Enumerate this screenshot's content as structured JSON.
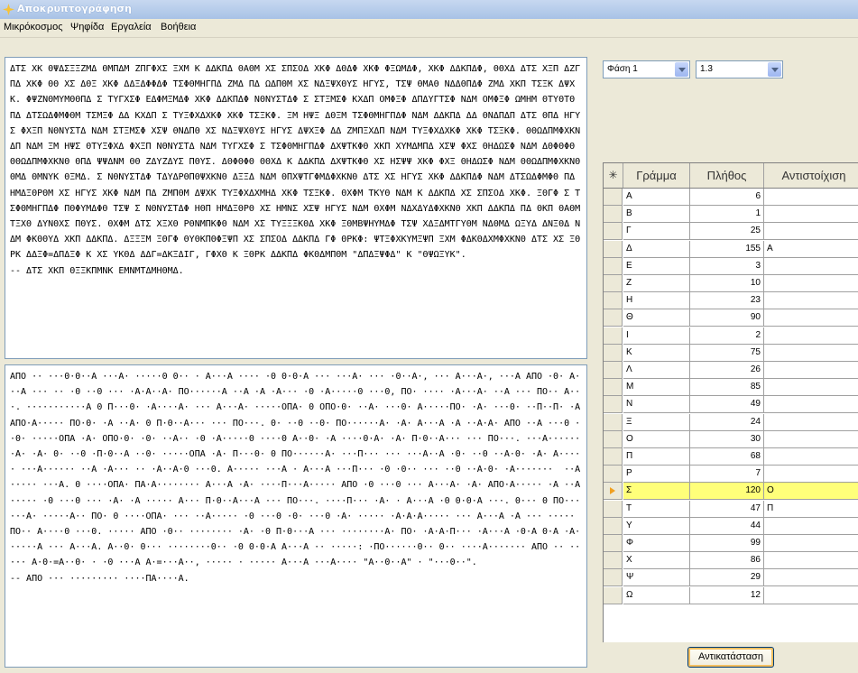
{
  "window": {
    "title": "Αποκρυπτογράφηση"
  },
  "menu": [
    "Μικρόκοσμος",
    "Ψηφίδα",
    "Εργαλεία",
    "Βοήθεια"
  ],
  "cipher_text": "ΔΤΣ ΧΚ ΘΨΔΣΞΞΖΜΔ ΘΜΠΔΜ ΖΠΓΦΧΣ ΞΧΜ Κ ΔΔΚΠΔ ΘΑΘΜ ΧΣ ΣΠΣΟΔ ΧΚΦ ΔΘΔΦ ΧΚΦ ΦΞΩΜΔΦ, ΧΚΦ ΔΔΚΠΔΦ, ΘΘΧΔ ΔΤΣ ΧΞΠ ΔΖΓΠΔ ΧΚΦ ΘΘ ΧΣ ΔΘΞ ΧΚΦ ΔΔΞΔΦΦΔΦ ΤΣΦΘΜΗΓΠΔ ΖΜΔ ΠΔ ΩΔΠΘΜ ΧΣ ΝΔΞΨΧΘΥΣ ΗΓΥΣ, ΤΣΨ ΘΜΑΘ ΝΔΔΘΠΔΦ ΖΜΔ ΧΚΠ ΤΣΞΚ ΔΨΧΚ. ΦΨΖΝΘΜΥΜΘΘΠΔ Σ ΤΥΓΧΣΦ ΕΔΦΜΞΜΔΦ ΧΚΦ ΔΔΚΠΔΦ ΝΘΝΥΣΤΔΦ Σ ΣΤΞΜΣΦ ΚΧΔΠ ΟΜΦΞΦ ΔΠΔΥΓΤΣΦ ΝΔΜ ΟΜΦΞΦ ΩΜΗΜ ΘΤΥΘΤΘ ΠΔ ΔΤΣΩΔΦΜΦΘΜ ΤΣΜΞΦ ΔΔ ΚΧΔΠ Σ ΤΥΞΦΧΔΧΚΦ ΧΚΦ ΤΣΞΚΦ. ΞΜ ΗΨΞ ΔΘΞΜ ΤΣΦΘΜΗΓΠΔΦ ΝΔΜ ΔΔΚΠΔ ΔΔ ΘΝΔΠΔΠ ΔΤΣ ΘΠΔ ΗΓΥΣ ΦΧΞΠ ΝΘΝΥΣΤΔ ΝΔΜ ΣΤΞΜΣΦ ΧΣΨ ΘΝΔΠΘ ΧΣ ΝΔΞΨΧΘΥΣ ΗΓΥΣ ΔΨΧΞΦ ΔΔ ΖΜΠΞΧΔΠ ΝΔΜ ΤΥΞΦΧΔΧΚΦ ΧΚΦ ΤΣΞΚΦ. ΘΘΩΔΠΜΦΧΚΝΔΠ ΝΔΜ ΞΜ ΗΨΣ ΘΤΥΞΦΧΔ ΦΧΞΠ ΝΘΝΥΣΤΔ ΝΔΜ ΤΥΓΧΣΦ Σ ΤΣΦΘΜΗΓΠΔΦ ΔΧΨΤΚΦΘ ΧΚΠ ΧΥΜΔΜΠΔ ΧΣΨ ΦΧΣ ΘΗΔΩΣΦ ΝΔΜ ΔΘΦΘΦΘ ΘΘΩΔΠΜΦΧΚΝΘ ΘΠΔ ΨΨΔΝΜ ΘΘ ΖΔΥΖΔΥΣ ΠΘΥΣ. ΔΘΦΘΦΘ ΘΘΧΔ Κ ΔΔΚΠΔ ΔΧΨΤΚΦΘ ΧΣ ΗΣΨΨ ΧΚΦ ΦΧΞ ΘΗΔΩΣΦ ΝΔΜ ΘΘΩΔΠΜΦΧΚΝΘ ΘΜΔ ΘΜΝΥΚ ΘΞΜΔ. Σ ΝΘΝΥΣΤΔΦ ΤΔΥΔΡΘΠΘΨΧΚΝΘ ΔΞΞΔ ΝΔΜ ΘΠΧΨΤΓΦΜΔΦΧΚΝΘ ΔΤΣ ΧΣ ΗΓΥΣ ΧΚΦ ΔΔΚΠΔΦ ΝΔΜ ΔΤΣΩΔΦΜΦΘ ΠΔ ΗΜΔΞΘΡΘΜ ΧΣ ΗΓΥΣ ΧΚΦ ΝΔΜ ΠΔ ΖΜΠΘΜ ΔΨΧΚ ΤΥΞΦΧΔΧΜΗΔ ΧΚΦ ΤΣΞΚΦ. ΘΧΦΜ ΤΚΥΘ ΝΔΜ Κ ΔΔΚΠΔ ΧΣ ΣΠΣΟΔ ΧΚΦ. ΞΘΓΦ Σ ΤΣΦΘΜΗΓΠΔΦ ΠΘΦΥΜΔΦΘ ΤΣΨ Σ ΝΘΝΥΣΤΔΦ ΗΘΠ ΗΜΔΞΘΡΘ ΧΣ ΗΜΝΣ ΧΣΨ ΗΓΥΣ ΝΔΜ ΘΧΦΜ ΝΔΧΔΥΔΦΧΚΝΘ ΧΚΠ ΔΔΚΠΔ ΠΔ ΘΚΠ ΘΑΘΜ ΤΞΧΘ ΔΥΝΘΧΣ ΠΘΥΣ. ΘΧΦΜ ΔΤΣ ΧΞΧΘ ΡΘΝΜΠΚΦΘ ΝΔΜ ΧΣ ΤΥΞΞΞΚΘΔ ΧΚΦ ΞΘΜΒΨΗΥΜΔΦ ΤΣΨ ΧΔΞΔΜΤΓΥΘΜ ΝΔΘΜΔ ΩΞΥΔ ΔΝΞΘΔ ΝΔΜ ΦΚΘΘΥΔ ΧΚΠ ΔΔΚΠΔ. ΔΞΞΞΜ ΞΘΓΦ ΘΥΘΚΠΘΦΞΨΠ ΧΣ ΣΠΣΟΔ ΔΔΚΠΔ ΓΦ ΘΡΚΦ: ΨΤΞΦΧΚΥΜΞΨΠ ΞΧΜ ΦΔΚΘΔΧΜΦΧΚΝΘ ΔΤΣ ΧΣ ΞΘΡΚ ΔΔΞΦ=ΔΠΔΞΦ Κ ΧΣ ΥΚΘΔ ΔΔΓ=ΔΚΞΔΙΓ, ΓΦΧΘ Κ ΞΘΡΚ ΔΔΚΠΔ ΦΚΘΔΜΠΘΜ \"ΔΠΔΞΨΦΔ\" Κ \"ΘΨΩΞΥΚ\".\n-- ΔΤΣ ΧΚΠ ΘΞΞΚΠΜΝΚ ΕΜΝΜΤΔΜΗΘΜΔ.",
  "plain_text": "ΑΠΟ ·· ···0·0··Α ···Α· ·····0 0·· · Α···Α ···· ·0 0·0·Α ··· ···Α· ··· ·0··Α·, ··· Α···Α·, ···Α ΑΠΟ ·0· Α···Α ··· ·· ·0 ··0 ··· ·Α·Α··Α· ΠΟ······Α ··Α ·Α ·Α··· ·0 ·Α·····0 ···0, ΠΟ· ···· ·Α···Α· ··Α ··· ΠΟ·· Α···. ···········Α 0 Π···0· ·Α····Α· ··· Α···Α· ·····ΟΠΑ· 0 ΟΠΟ·0· ··Α· ···0· Α·····ΠΟ· ·Α· ···0· ··Π··Π· ·Α ΑΠΟ·Α····· ΠΟ·0· ·Α ··Α· 0 Π·0··Α··· ··· ΠΟ···. 0· ··0 ··0· ΠΟ······Α· ·Α· Α···Α ·Α ··Α·Α· ΑΠΟ ··Α ···0 ··0· ·····ΟΠΑ ·Α· ΟΠΟ·0· ·0· ··Α·· ·0 ·Α·····0 ····0 Α··0· ·Α ····0·Α· ·Α· Π·0··Α··· ··· ΠΟ···. ···Α·······Α· ·Α· 0· ··0 ·Π·0··Α ··0· ·····ΟΠΑ ·Α· Π···0· 0 ΠΟ······Α· ···Π··· ··· ···Α··Α ·0· ··0 ··Α·0· ·Α· Α····· ···Α······ ··Α ·Α··· ·· ·Α··Α·0 ···0. Α····· ···Α · Α···Α ···Π··· ·0 ·0·· ··· ··0 ··Α·0· ·Α·······  ··Α ····· ···Α. 0 ····ΟΠΑ· ΠΑ·Α········ Α···Α ·Α· ····Π···Α····· ΑΠΟ ·0 ···0 ··· Α···Α· ·Α· ΑΠΟ·Α····· ·Α ··Α····· ·0 ···0 ··· ·Α· ·Α ····· Α··· Π·0··Α···Α ··· ΠΟ···. ····Π··· ·Α· · Α···Α ·0 0·0·Α ···. 0··· 0 ΠΟ······Α· ·····Α·· ΠΟ· 0 ····ΟΠΑ· ··· ··Α····· ·0 ···0 ·0· ···0 ·Α· ····· ·Α·Α·Α····· ··· Α···Α ·Α ··· ····· ΠΟ·· Α····0 ···0. ····· ΑΠΟ ·0·· ········ ·Α· ·0 Π·0···Α ··· ········Α· ΠΟ· ·Α·Α·Π··· ·Α···Α ·0·Α 0·Α ·Α· ·····Α ··· Α···Α. Α··0· 0··· ········0·· ·0 0·0·Α Α···Α ·· ·····: ·ΠΟ······0·· 0·· ····Α······· ΑΠΟ ·· ····· Α·0·=Α··0· · ·0 ···Α Α·=···Α··, ····· · ····· Α···Α ···Α···· \"Α··0··Α\" · \"···0··\".\n-- ΑΠΟ ··· ········· ····ΠΑ····Α.",
  "phase_select": {
    "value": "Φάση 1"
  },
  "ratio_select": {
    "value": "1.3"
  },
  "table": {
    "headers": [
      "Γράμμα",
      "Πλήθος",
      "Αντιστοίχιση"
    ],
    "star": "✳",
    "selected_index": 17,
    "rows": [
      {
        "letter": "Α",
        "count": "6",
        "map": ""
      },
      {
        "letter": "Β",
        "count": "1",
        "map": ""
      },
      {
        "letter": "Γ",
        "count": "25",
        "map": ""
      },
      {
        "letter": "Δ",
        "count": "155",
        "map": "Α"
      },
      {
        "letter": "Ε",
        "count": "3",
        "map": ""
      },
      {
        "letter": "Ζ",
        "count": "10",
        "map": ""
      },
      {
        "letter": "Η",
        "count": "23",
        "map": ""
      },
      {
        "letter": "Θ",
        "count": "90",
        "map": ""
      },
      {
        "letter": "Ι",
        "count": "2",
        "map": ""
      },
      {
        "letter": "Κ",
        "count": "75",
        "map": ""
      },
      {
        "letter": "Λ",
        "count": "26",
        "map": ""
      },
      {
        "letter": "Μ",
        "count": "85",
        "map": ""
      },
      {
        "letter": "Ν",
        "count": "49",
        "map": ""
      },
      {
        "letter": "Ξ",
        "count": "24",
        "map": ""
      },
      {
        "letter": "Ο",
        "count": "30",
        "map": ""
      },
      {
        "letter": "Π",
        "count": "68",
        "map": ""
      },
      {
        "letter": "Ρ",
        "count": "7",
        "map": ""
      },
      {
        "letter": "Σ",
        "count": "120",
        "map": "Ο"
      },
      {
        "letter": "Τ",
        "count": "47",
        "map": "Π"
      },
      {
        "letter": "Υ",
        "count": "44",
        "map": ""
      },
      {
        "letter": "Φ",
        "count": "99",
        "map": ""
      },
      {
        "letter": "Χ",
        "count": "86",
        "map": ""
      },
      {
        "letter": "Ψ",
        "count": "29",
        "map": ""
      },
      {
        "letter": "Ω",
        "count": "12",
        "map": ""
      }
    ]
  },
  "replace_button": {
    "label": "Αντικατάσταση"
  }
}
